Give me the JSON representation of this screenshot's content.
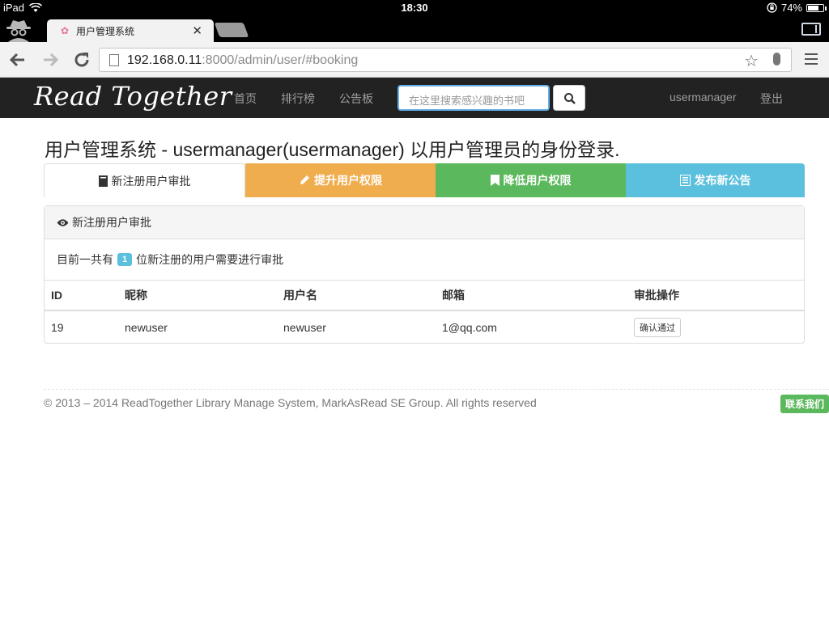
{
  "status_bar": {
    "device": "iPad",
    "time": "18:30",
    "battery": "74%",
    "battery_level": 0.74
  },
  "browser": {
    "tab_title": "用户管理系统",
    "url_host": "192.168.0.11",
    "url_rest": ":8000/admin/user/#booking"
  },
  "site": {
    "brand": "Read Together",
    "nav": [
      "首页",
      "排行榜",
      "公告板"
    ],
    "search_placeholder": "在这里搜索感兴趣的书吧",
    "username": "usermanager",
    "logout": "登出"
  },
  "main": {
    "title": "用户管理系统 - usermanager(usermanager) 以用户管理员的身份登录.",
    "tabs": [
      {
        "label": "新注册用户审批",
        "color": "#ffffff"
      },
      {
        "label": "提升用户权限",
        "color": "#f0ad4e"
      },
      {
        "label": "降低用户权限",
        "color": "#5cb85c"
      },
      {
        "label": "发布新公告",
        "color": "#5bc0de"
      }
    ],
    "panel_title": "新注册用户审批",
    "summary_prefix": "目前一共有",
    "summary_count": "1",
    "summary_suffix": "位新注册的用户需要进行审批",
    "table": {
      "headers": [
        "ID",
        "昵称",
        "用户名",
        "邮箱",
        "审批操作"
      ],
      "rows": [
        {
          "id": "19",
          "nickname": "newuser",
          "username": "newuser",
          "email": "1@qq.com",
          "action": "确认通过"
        }
      ]
    }
  },
  "footer": {
    "text": "© 2013 – 2014 ReadTogether Library Manage System, MarkAsRead SE Group. All rights reserved",
    "contact": "联系我们"
  }
}
